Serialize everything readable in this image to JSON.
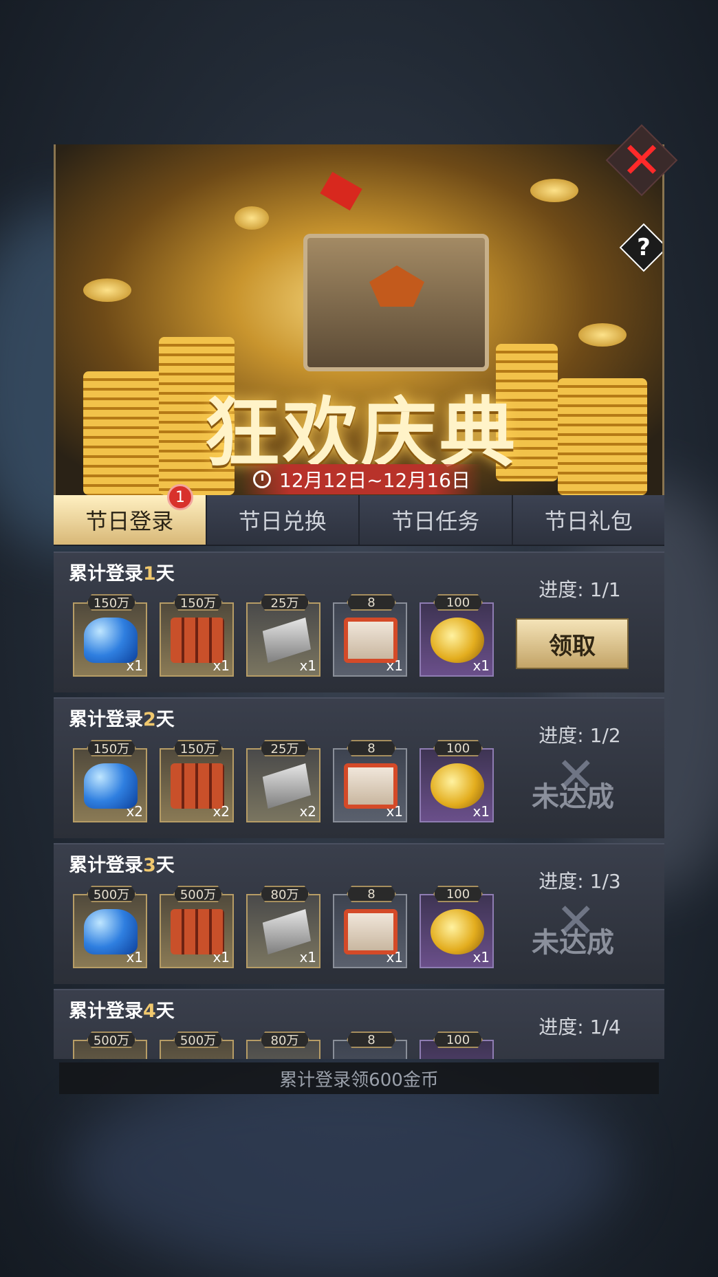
{
  "banner": {
    "title": "狂欢庆典",
    "date_range": "12月12日~12月16日"
  },
  "tabs": [
    {
      "label": "节日登录",
      "active": true,
      "badge": "1"
    },
    {
      "label": "节日兑换",
      "active": false
    },
    {
      "label": "节日任务",
      "active": false
    },
    {
      "label": "节日礼包",
      "active": false
    }
  ],
  "rows": [
    {
      "title_prefix": "累计登录",
      "day": "1",
      "title_suffix": "天",
      "progress": "进度: 1/1",
      "action": "领取",
      "items": [
        {
          "type": "gem",
          "amount": "150万",
          "mult": "x1"
        },
        {
          "type": "oil",
          "amount": "150万",
          "mult": "x1"
        },
        {
          "type": "steel",
          "amount": "25万",
          "mult": "x1"
        },
        {
          "type": "ticket",
          "amount": "8",
          "mult": "x1"
        },
        {
          "type": "coin",
          "amount": "100",
          "mult": "x1"
        }
      ]
    },
    {
      "title_prefix": "累计登录",
      "day": "2",
      "title_suffix": "天",
      "progress": "进度: 1/2",
      "status": "未达成",
      "items": [
        {
          "type": "gem",
          "amount": "150万",
          "mult": "x2"
        },
        {
          "type": "oil",
          "amount": "150万",
          "mult": "x2"
        },
        {
          "type": "steel",
          "amount": "25万",
          "mult": "x2"
        },
        {
          "type": "ticket",
          "amount": "8",
          "mult": "x1"
        },
        {
          "type": "coin",
          "amount": "100",
          "mult": "x1"
        }
      ]
    },
    {
      "title_prefix": "累计登录",
      "day": "3",
      "title_suffix": "天",
      "progress": "进度: 1/3",
      "status": "未达成",
      "items": [
        {
          "type": "gem",
          "amount": "500万",
          "mult": "x1"
        },
        {
          "type": "oil",
          "amount": "500万",
          "mult": "x1"
        },
        {
          "type": "steel",
          "amount": "80万",
          "mult": "x1"
        },
        {
          "type": "ticket",
          "amount": "8",
          "mult": "x1"
        },
        {
          "type": "coin",
          "amount": "100",
          "mult": "x1"
        }
      ]
    },
    {
      "title_prefix": "累计登录",
      "day": "4",
      "title_suffix": "天",
      "progress": "进度: 1/4",
      "items": [
        {
          "type": "gem",
          "amount": "500万",
          "mult": ""
        },
        {
          "type": "oil",
          "amount": "500万",
          "mult": ""
        },
        {
          "type": "steel",
          "amount": "80万",
          "mult": ""
        },
        {
          "type": "ticket",
          "amount": "8",
          "mult": ""
        },
        {
          "type": "coin",
          "amount": "100",
          "mult": ""
        }
      ]
    }
  ],
  "footer": "累计登录领600金币",
  "icons": {
    "close": "close-icon",
    "help": "question-icon",
    "clock": "clock-icon"
  },
  "colors": {
    "accent_gold": "#f0c86e",
    "close_red": "#ff2a2a",
    "badge_red": "#d8312c"
  }
}
